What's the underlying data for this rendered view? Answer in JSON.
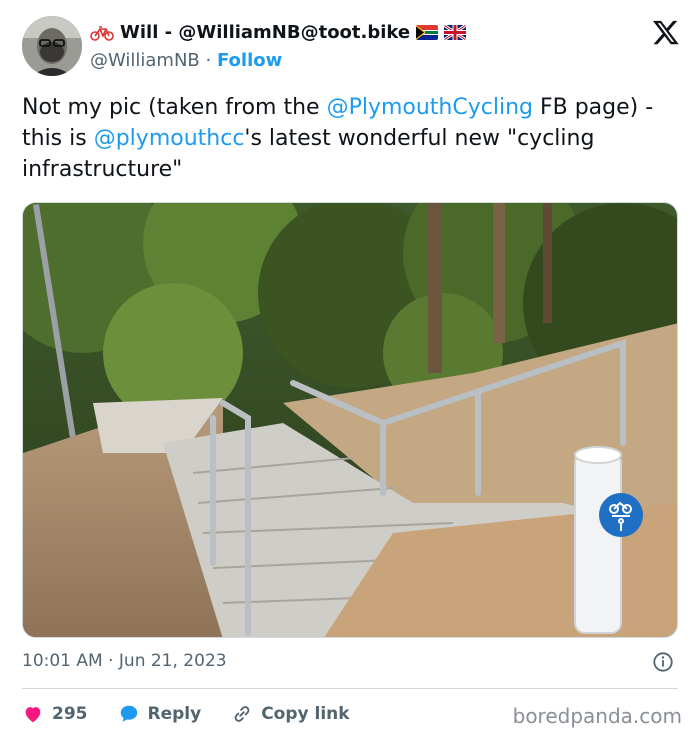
{
  "author": {
    "display_name": "Will - @WilliamNB@toot.bike",
    "handle": "@WilliamNB",
    "separator": "·",
    "follow_label": "Follow"
  },
  "tweet": {
    "text_parts": [
      "Not my pic (taken from the ",
      "@PlymouthCycling",
      " FB page) - this is ",
      "@plymouthcc",
      "'s latest wonderful new \"cycling infrastructure\""
    ],
    "timestamp": "10:01 AM · Jun 21, 2023"
  },
  "actions": {
    "like_count": "295",
    "reply_label": "Reply",
    "copy_link_label": "Copy link"
  },
  "watermark": "boredpanda.com",
  "colors": {
    "accent": "#1d9bf0",
    "like": "#f91880",
    "muted": "#536471",
    "text": "#0f1419"
  },
  "icons": {
    "bike": "bicycle-emoji-icon",
    "flag_1": "south-africa-flag-icon",
    "flag_2": "uk-flag-icon",
    "logo": "x-logo-icon",
    "info": "info-icon",
    "like": "heart-icon",
    "reply": "speech-bubble-icon",
    "copy": "link-icon"
  }
}
